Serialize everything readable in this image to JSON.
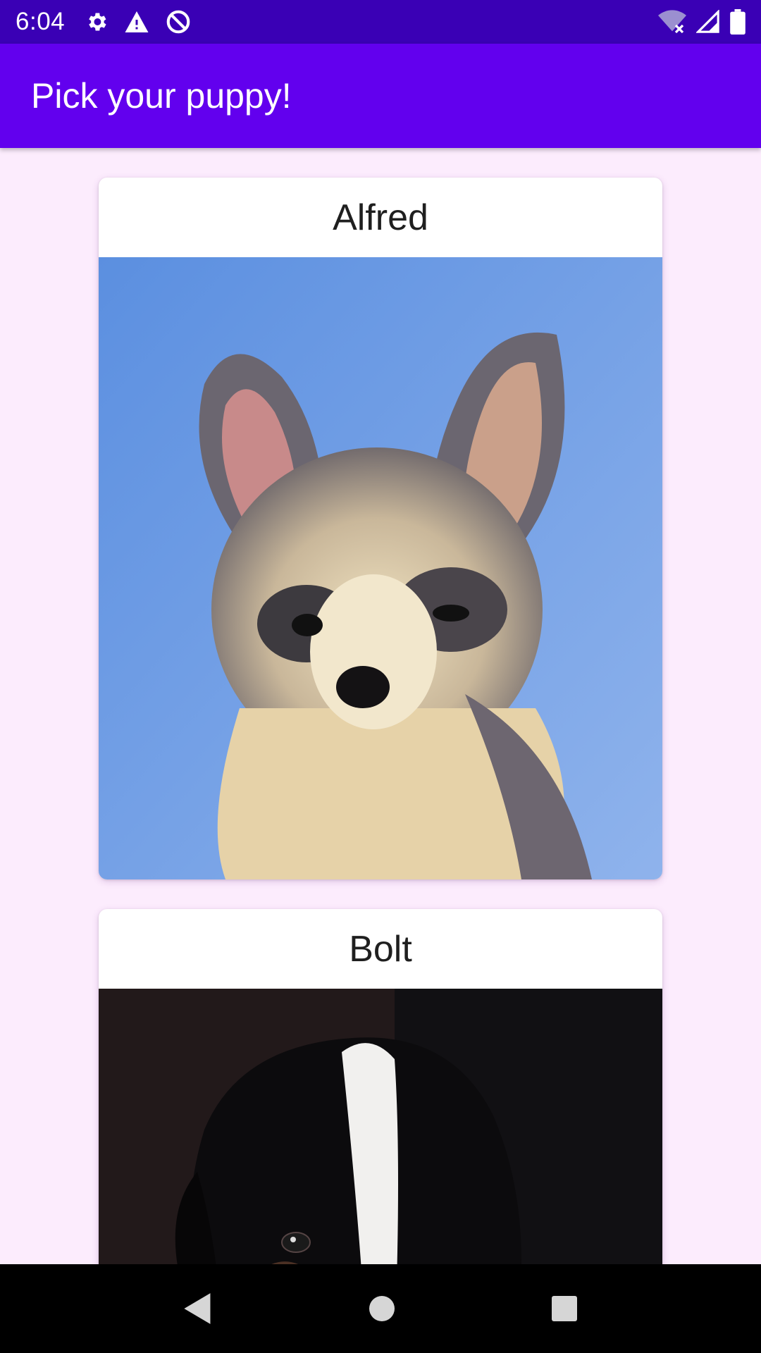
{
  "status_bar": {
    "time": "6:04",
    "icons_left": [
      "settings-icon",
      "warning-icon",
      "data-saver-icon"
    ],
    "icons_right": [
      "wifi-off-icon",
      "cell-signal-icon",
      "battery-icon"
    ]
  },
  "app_bar": {
    "title": "Pick your puppy!",
    "color": "#6200ee"
  },
  "puppies": [
    {
      "name": "Alfred",
      "photo": "chihuahua puppy against blue sky"
    },
    {
      "name": "Bolt",
      "photo": "black and white puppy on dark background"
    }
  ],
  "nav_bar": {
    "buttons": [
      "back-icon",
      "home-icon",
      "recents-icon"
    ]
  }
}
